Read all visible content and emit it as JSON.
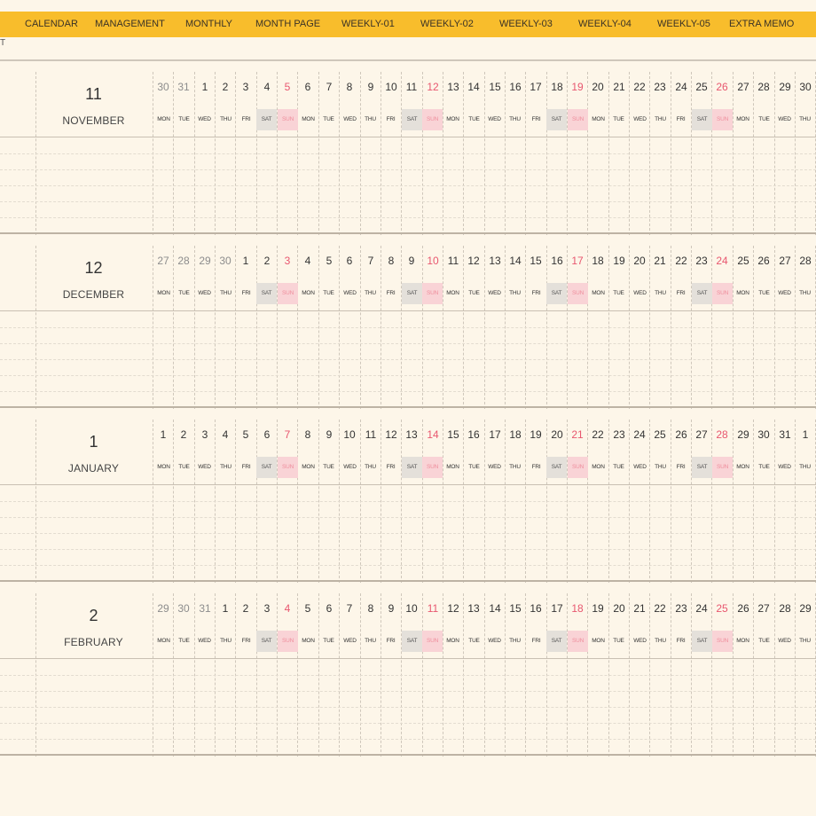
{
  "nav": {
    "items": [
      "CALENDAR",
      "MANAGEMENT",
      "MONTHLY",
      "MONTH PAGE",
      "WEEKLY-01",
      "WEEKLY-02",
      "WEEKLY-03",
      "WEEKLY-04",
      "WEEKLY-05",
      "EXTRA MEMO"
    ]
  },
  "corner_mark": "T",
  "weekday_labels": [
    "MON",
    "TUE",
    "WED",
    "THU",
    "FRI",
    "SAT",
    "SUN"
  ],
  "months": [
    {
      "number": "11",
      "name": "NOVEMBER",
      "days": [
        "30",
        "31",
        "1",
        "2",
        "3",
        "4",
        "5",
        "6",
        "7",
        "8",
        "9",
        "10",
        "11",
        "12",
        "13",
        "14",
        "15",
        "16",
        "17",
        "18",
        "19",
        "20",
        "21",
        "22",
        "23",
        "24",
        "25",
        "26",
        "27",
        "28",
        "29",
        "30"
      ],
      "leading_outside_days": 2
    },
    {
      "number": "12",
      "name": "DECEMBER",
      "days": [
        "27",
        "28",
        "29",
        "30",
        "1",
        "2",
        "3",
        "4",
        "5",
        "6",
        "7",
        "8",
        "9",
        "10",
        "11",
        "12",
        "13",
        "14",
        "15",
        "16",
        "17",
        "18",
        "19",
        "20",
        "21",
        "22",
        "23",
        "24",
        "25",
        "26",
        "27",
        "28"
      ],
      "leading_outside_days": 4
    },
    {
      "number": "1",
      "name": "JANUARY",
      "days": [
        "1",
        "2",
        "3",
        "4",
        "5",
        "6",
        "7",
        "8",
        "9",
        "10",
        "11",
        "12",
        "13",
        "14",
        "15",
        "16",
        "17",
        "18",
        "19",
        "20",
        "21",
        "22",
        "23",
        "24",
        "25",
        "26",
        "27",
        "28",
        "29",
        "30",
        "31",
        "1"
      ],
      "leading_outside_days": 0
    },
    {
      "number": "2",
      "name": "FEBRUARY",
      "days": [
        "29",
        "30",
        "31",
        "1",
        "2",
        "3",
        "4",
        "5",
        "6",
        "7",
        "8",
        "9",
        "10",
        "11",
        "12",
        "13",
        "14",
        "15",
        "16",
        "17",
        "18",
        "19",
        "20",
        "21",
        "22",
        "23",
        "24",
        "25",
        "26",
        "27",
        "28",
        "29"
      ],
      "leading_outside_days": 3
    }
  ],
  "colors": {
    "nav_background": "#f8bd2c",
    "page_background": "#fdf6e9",
    "sunday_text": "#e8576f",
    "sunday_fill": "#f9d3d6",
    "saturday_fill": "#e4e0da"
  }
}
